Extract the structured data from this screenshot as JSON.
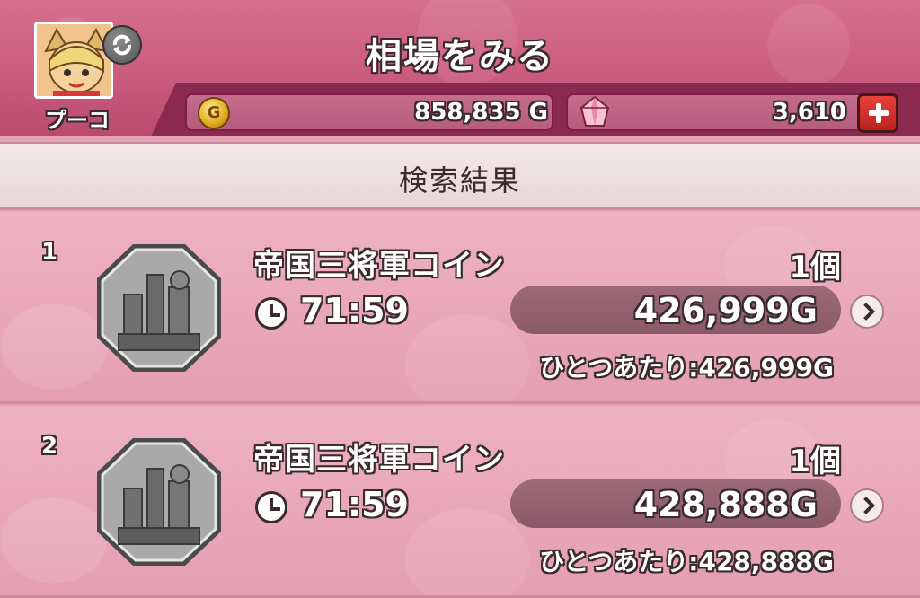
{
  "header": {
    "title": "相場をみる",
    "player_name": "プーコ",
    "gold_amount": "858,835 G",
    "gem_amount": "3,610"
  },
  "results": {
    "title": "検索結果"
  },
  "listings": [
    {
      "rank": "1",
      "item_name": "帝国三将軍コイン",
      "quantity": "1個",
      "time_remaining": "71:59",
      "price": "426,999G",
      "per_unit": "ひとつあたり:426,999G"
    },
    {
      "rank": "2",
      "item_name": "帝国三将軍コイン",
      "quantity": "1個",
      "time_remaining": "71:59",
      "price": "428,888G",
      "per_unit": "ひとつあたり:428,888G"
    }
  ],
  "icons": {
    "gold": "gold-coin-icon",
    "gem": "gem-icon",
    "add": "plus-icon",
    "refresh": "refresh-icon",
    "clock": "clock-icon",
    "next": "chevron-right-icon",
    "coin_item": "coin-item-icon"
  },
  "colors": {
    "header": "#c95a7d",
    "currency_bar": "#8b2a4f",
    "list_background": "#eeb2c2",
    "add_button": "#d8302c"
  }
}
